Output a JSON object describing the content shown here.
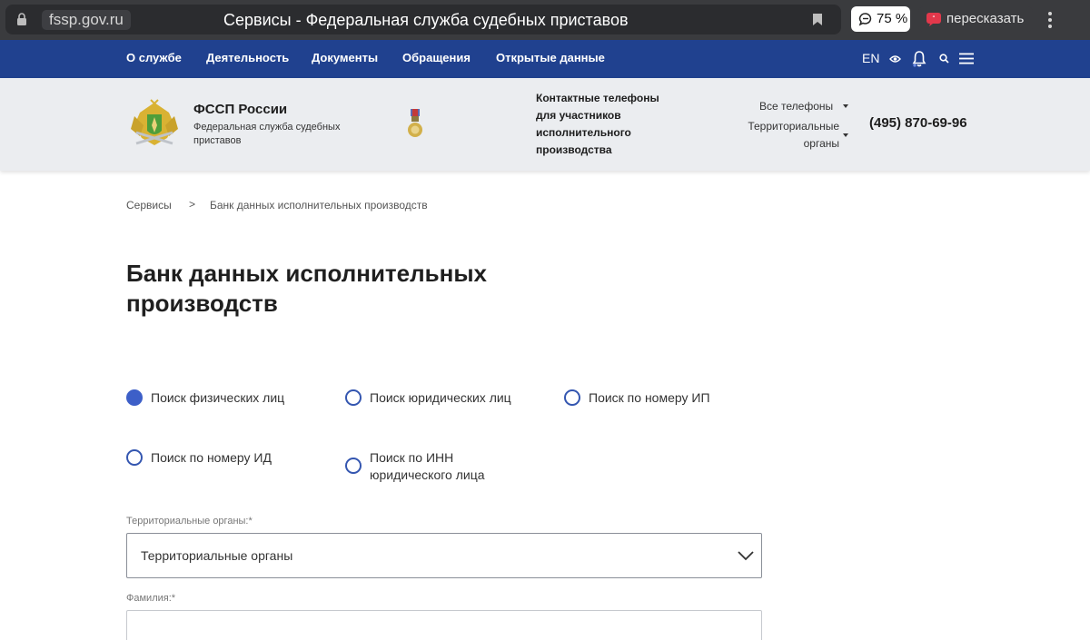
{
  "browser": {
    "domain": "fssp.gov.ru",
    "tab_title": "Сервисы - Федеральная служба судебных приставов",
    "zoom": "75 %",
    "retell_label": "пересказать"
  },
  "nav": {
    "items": [
      {
        "label": "О службе"
      },
      {
        "label": "Деятельность"
      },
      {
        "label": "Документы"
      },
      {
        "label": "Обращения"
      },
      {
        "label": "Открытые данные"
      }
    ],
    "lang": "EN"
  },
  "header": {
    "org_title": "ФССП России",
    "org_subtitle": "Федеральная служба судебных приставов",
    "contact_label": "Контактные телефоны для участников исполнительного производства",
    "all_phones": "Все телефоны",
    "territorial": "Территориальные органы",
    "phone": "(495) 870-69-96"
  },
  "breadcrumb": {
    "items": [
      "Сервисы",
      "Банк данных исполнительных производств"
    ],
    "separator": ">"
  },
  "page_title": "Банк данных исполнительных производств",
  "search_types": [
    {
      "label": "Поиск физических лиц",
      "checked": true
    },
    {
      "label": "Поиск юридических лиц",
      "checked": false
    },
    {
      "label": "Поиск по номеру ИП",
      "checked": false
    },
    {
      "label": "Поиск по номеру ИД",
      "checked": false
    },
    {
      "label": "Поиск по ИНН юридического лица",
      "checked": false
    }
  ],
  "form": {
    "territorial_label": "Территориальные органы:*",
    "territorial_value": "Территориальные органы",
    "lastname_label": "Фамилия:*",
    "lastname_value": ""
  },
  "colors": {
    "nav_bg": "#20418f",
    "header_bg": "#ebedf0",
    "radio_accent": "#3d5fc8"
  }
}
